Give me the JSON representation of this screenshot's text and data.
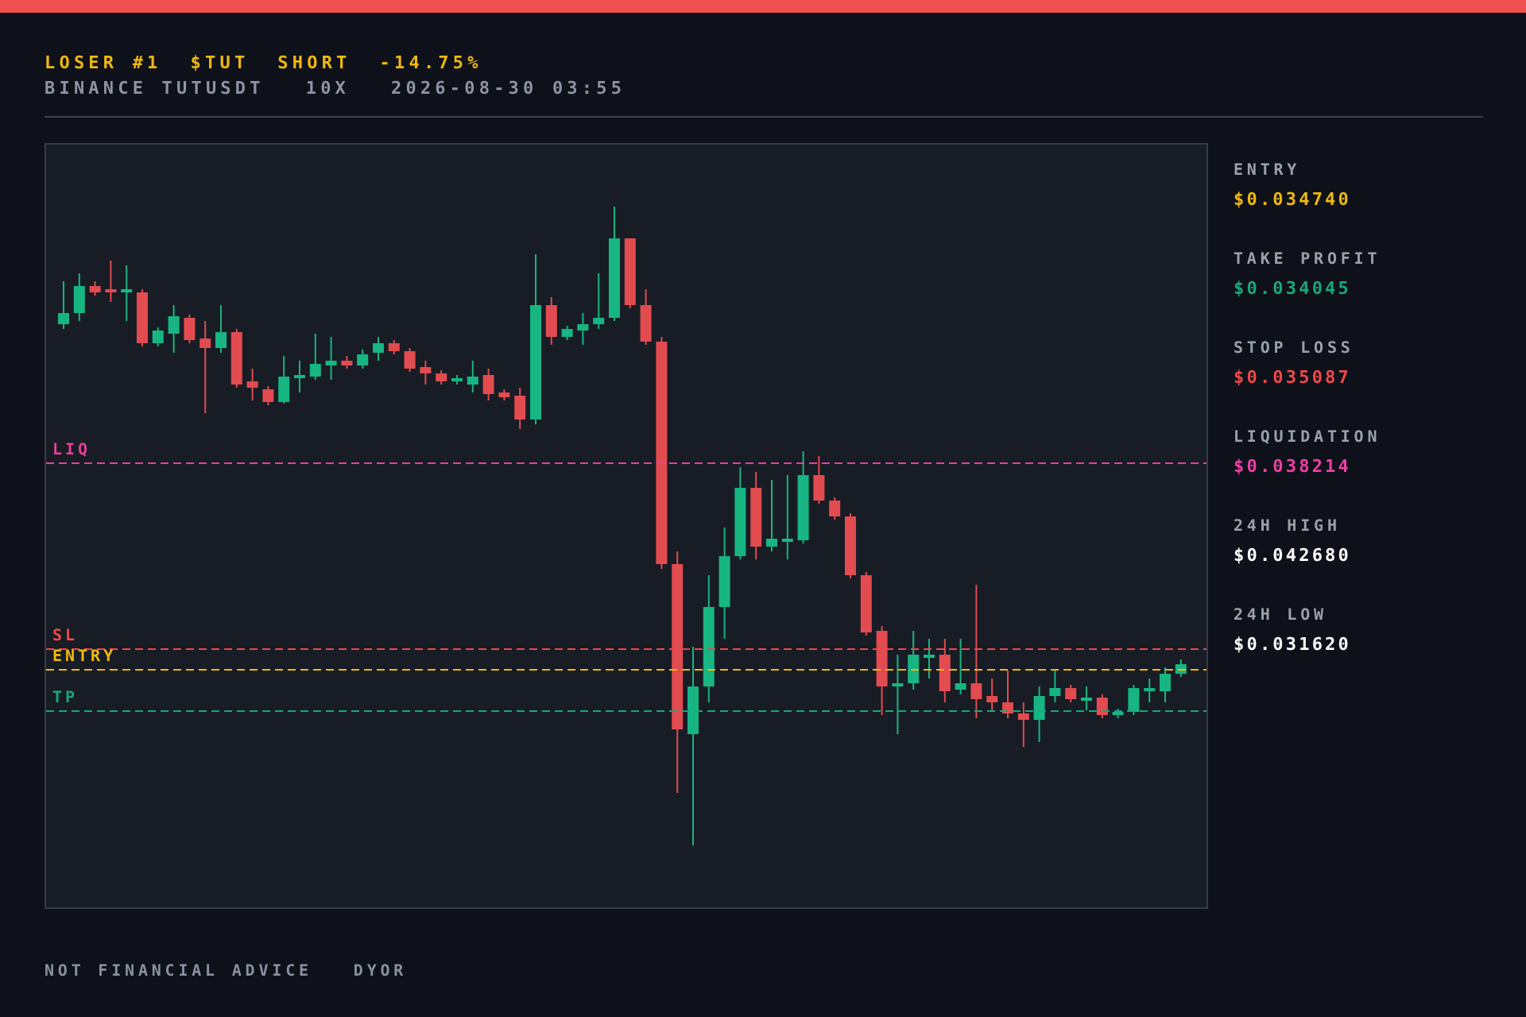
{
  "header": {
    "title_parts": [
      "LOSER #1",
      "$TUT",
      "SHORT",
      "-14.75%"
    ],
    "meta_parts": [
      "BINANCE TUTUSDT",
      "10X",
      "2026-08-30 03:55"
    ]
  },
  "chart": {
    "levels": [
      {
        "kind": "liq",
        "label": "LIQ",
        "color": "#e8409c"
      },
      {
        "kind": "sl",
        "label": "SL",
        "color": "#f0484a"
      },
      {
        "kind": "entry",
        "label": "ENTRY",
        "color": "#f0b90b"
      },
      {
        "kind": "tp",
        "label": "TP",
        "color": "#17a87a"
      }
    ]
  },
  "stats": [
    {
      "label": "ENTRY",
      "value": "$0.034740",
      "color": "#f0b90b"
    },
    {
      "label": "TAKE PROFIT",
      "value": "$0.034045",
      "color": "#17a87a"
    },
    {
      "label": "STOP LOSS",
      "value": "$0.035087",
      "color": "#f0484a"
    },
    {
      "label": "LIQUIDATION",
      "value": "$0.038214",
      "color": "#f03fa4"
    },
    {
      "label": "24H HIGH",
      "value": "$0.042680",
      "color": "#ffffff"
    },
    {
      "label": "24H LOW",
      "value": "$0.031620",
      "color": "#ffffff"
    }
  ],
  "footer": [
    "NOT FINANCIAL ADVICE",
    "DYOR"
  ]
}
